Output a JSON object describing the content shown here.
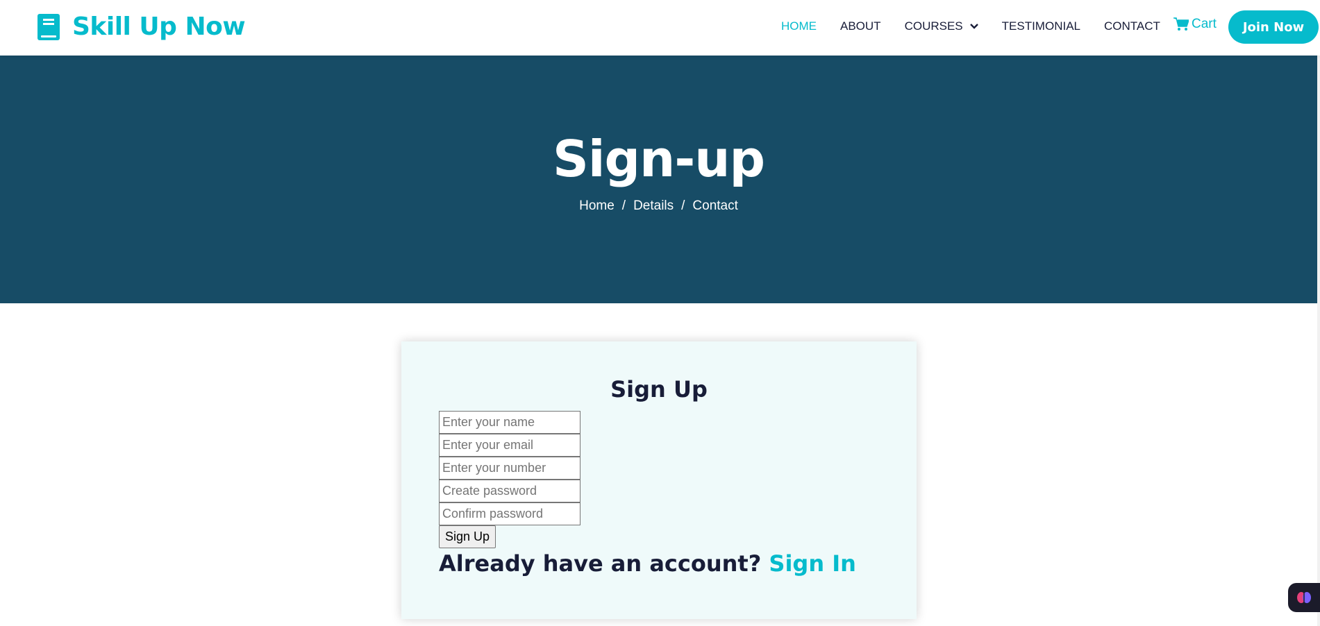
{
  "navbar": {
    "brand": "Skill Up Now",
    "links": [
      {
        "label": "HOME",
        "active": true
      },
      {
        "label": "ABOUT",
        "active": false
      },
      {
        "label": "COURSES",
        "active": false,
        "dropdown": true
      },
      {
        "label": "TESTIMONIAL",
        "active": false
      },
      {
        "label": "CONTACT",
        "active": false
      }
    ],
    "cart_label": "Cart",
    "join_label": "Join Now"
  },
  "hero": {
    "title": "Sign-up",
    "breadcrumb": [
      "Home",
      "Details",
      "Contact"
    ],
    "separator": "/"
  },
  "form": {
    "title": "Sign Up",
    "fields": {
      "name_placeholder": "Enter your name",
      "email_placeholder": "Enter your email",
      "number_placeholder": "Enter your number",
      "password_placeholder": "Create password",
      "confirm_placeholder": "Confirm password"
    },
    "submit_label": "Sign Up",
    "account_prompt": "Already have an account?",
    "signin_label": "Sign In"
  },
  "colors": {
    "accent": "#06bbcc",
    "hero_bg": "#174c66",
    "dark_text": "#181d38",
    "card_bg": "#effafa"
  },
  "icons": {
    "brand": "book-icon",
    "cart": "cart-icon",
    "courses_dropdown": "chevron-down-icon",
    "widget": "brain-icon"
  }
}
